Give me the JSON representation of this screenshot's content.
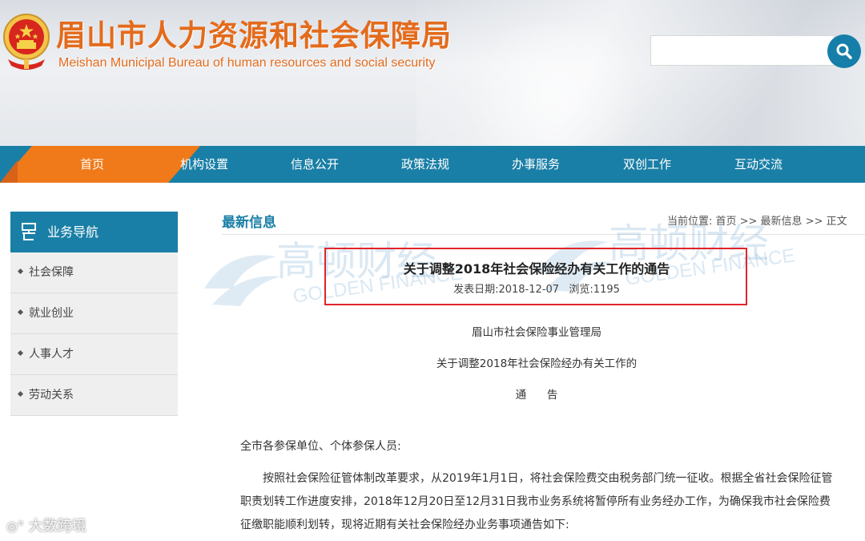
{
  "header": {
    "title": "眉山市人力资源和社会保障局",
    "subtitle": "Meishan Municipal Bureau of human resources and social security",
    "search_placeholder": ""
  },
  "nav": {
    "items": [
      "首页",
      "机构设置",
      "信息公开",
      "政策法规",
      "办事服务",
      "双创工作",
      "互动交流"
    ],
    "active": "首页",
    "color": "#1a7fa6",
    "active_color": "#f07a1a"
  },
  "sidebar": {
    "title": "业务导航",
    "items": [
      "社会保障",
      "就业创业",
      "人事人才",
      "劳动关系"
    ]
  },
  "main": {
    "heading": "最新信息",
    "breadcrumb": "当前位置: 首页 >> 最新信息 >> 正文",
    "watermark_cn": "高顿财经",
    "watermark_en": "GOLDEN FINANCE"
  },
  "article": {
    "title": "关于调整2018年社会保险经办有关工作的通告",
    "meta": "发表日期:2018-12-07   浏览:1195",
    "issuer": "眉山市社会保险事业管理局",
    "doc_title_1": "关于调整2018年社会保险经办有关工作的",
    "doc_title_2": "通      告",
    "salutation": "全市各参保单位、个体参保人员:",
    "paragraph": "按照社会保险征管体制改革要求，从2019年1月1日，将社会保险费交由税务部门统一征收。根据全省社会保险征管职责划转工作进度安排，2018年12月20日至12月31日我市业务系统将暂停所有业务经办工作，为确保我市社会保险费征缴职能顺利划转，现将近期有关社会保险经办业务事项通告如下:"
  },
  "corner_watermark": "大数跨境",
  "highlight_color": "#e0242a"
}
